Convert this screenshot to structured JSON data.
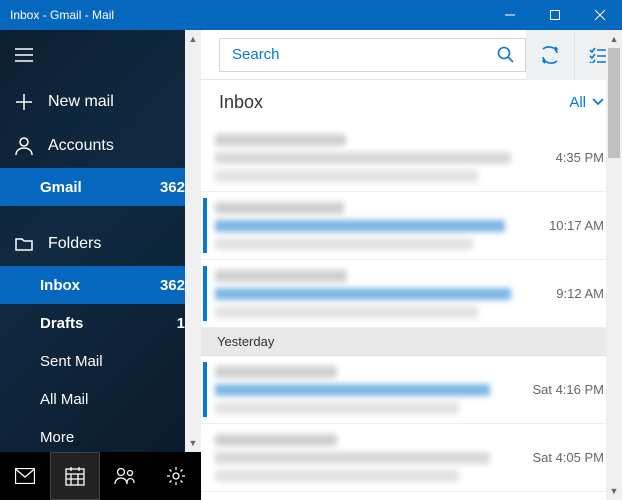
{
  "window": {
    "title": "Inbox - Gmail - Mail"
  },
  "sidebar": {
    "new_mail": "New mail",
    "accounts_label": "Accounts",
    "account": {
      "name": "Gmail",
      "count": "362"
    },
    "folders_label": "Folders",
    "folders": [
      {
        "label": "Inbox",
        "count": "362",
        "bold": true,
        "selected": true
      },
      {
        "label": "Drafts",
        "count": "1",
        "bold": true,
        "selected": false
      },
      {
        "label": "Sent Mail",
        "count": "",
        "bold": false,
        "selected": false
      },
      {
        "label": "All Mail",
        "count": "",
        "bold": false,
        "selected": false
      },
      {
        "label": "More",
        "count": "",
        "bold": false,
        "selected": false
      }
    ]
  },
  "search": {
    "placeholder": "Search"
  },
  "list": {
    "header": "Inbox",
    "filter": "All",
    "groups": [
      {
        "label": "",
        "messages": [
          {
            "time": "4:35 PM",
            "unread": false
          },
          {
            "time": "10:17 AM",
            "unread": true
          },
          {
            "time": "9:12 AM",
            "unread": true
          }
        ]
      },
      {
        "label": "Yesterday",
        "messages": [
          {
            "time": "Sat 4:16 PM",
            "unread": true
          },
          {
            "time": "Sat 4:05 PM",
            "unread": false
          }
        ]
      }
    ]
  }
}
